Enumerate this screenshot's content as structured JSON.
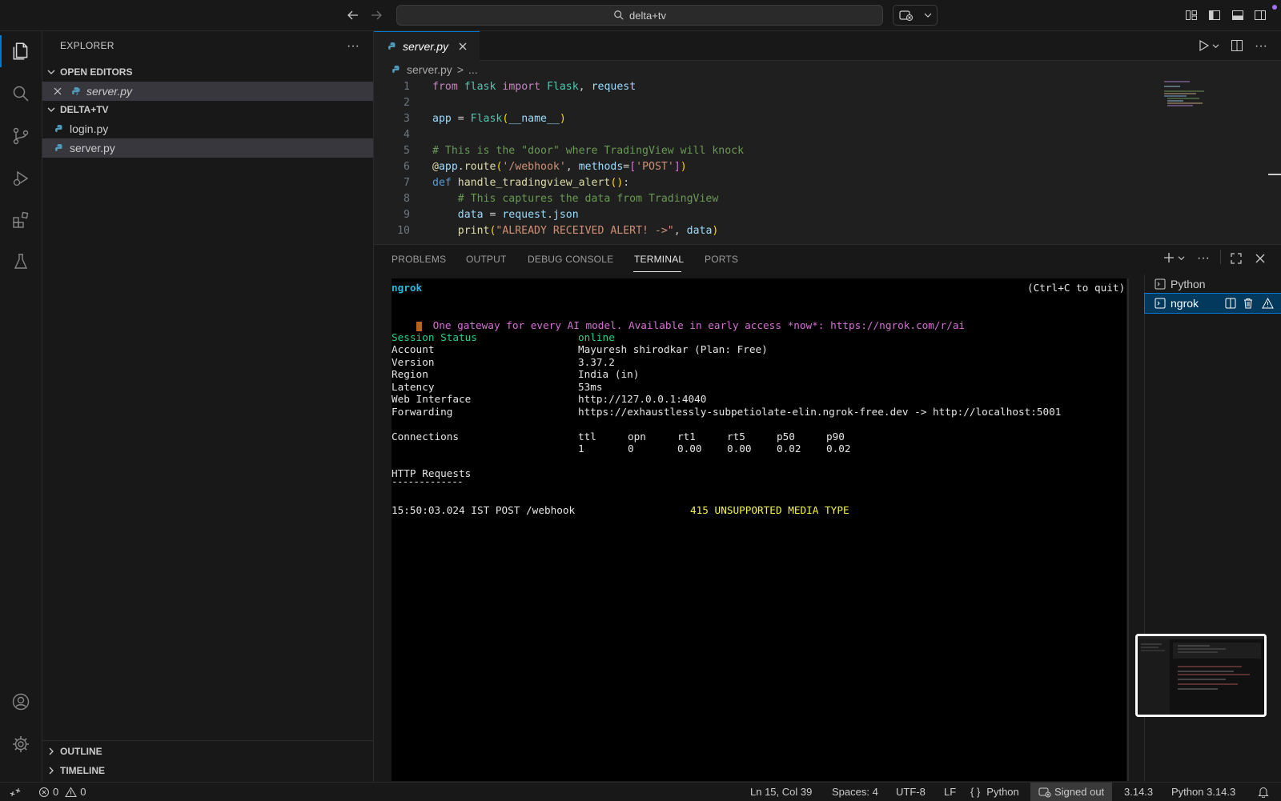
{
  "titlebar": {
    "search_text": "delta+tv"
  },
  "sidebar": {
    "title": "EXPLORER",
    "more": "···",
    "open_editors_label": "OPEN EDITORS",
    "open_editors": [
      {
        "label": "server.py"
      }
    ],
    "folder_label": "DELTA+TV",
    "files": [
      {
        "label": "login.py"
      },
      {
        "label": "server.py"
      }
    ],
    "outline_label": "OUTLINE",
    "timeline_label": "TIMELINE"
  },
  "editor": {
    "active_tab": "server.py",
    "breadcrumb": {
      "file": "server.py",
      "separator": ">",
      "rest": "..."
    },
    "line_numbers": [
      "1",
      "2",
      "3",
      "4",
      "5",
      "6",
      "7",
      "8",
      "9",
      "10"
    ],
    "lines": [
      "from flask import Flask, request",
      "",
      "app = Flask(__name__)",
      "",
      "# This is the \"door\" where TradingView will knock",
      "@app.route('/webhook', methods=['POST'])",
      "def handle_tradingview_alert():",
      "    # This captures the data from TradingView",
      "    data = request.json",
      "    print(\"ALREADY RECEIVED ALERT! ->\", data)"
    ]
  },
  "panel": {
    "tabs": [
      {
        "label": "PROBLEMS"
      },
      {
        "label": "OUTPUT"
      },
      {
        "label": "DEBUG CONSOLE"
      },
      {
        "label": "TERMINAL"
      },
      {
        "label": "PORTS"
      }
    ],
    "active_tab": "TERMINAL",
    "terminals": [
      {
        "label": "Python"
      },
      {
        "label": "ngrok"
      }
    ]
  },
  "terminal": {
    "app_name": "ngrok",
    "quit_hint": "(Ctrl+C to quit)",
    "announcement": "One gateway for every AI model. Available in early access *now*: https://ngrok.com/r/ai",
    "session_status_label": "Session Status",
    "session_status_value": "online",
    "rows": [
      {
        "label": "Account",
        "value": "Mayuresh shirodkar (Plan: Free)"
      },
      {
        "label": "Version",
        "value": "3.37.2"
      },
      {
        "label": "Region",
        "value": "India (in)"
      },
      {
        "label": "Latency",
        "value": "53ms"
      },
      {
        "label": "Web Interface",
        "value": "http://127.0.0.1:4040"
      },
      {
        "label": "Forwarding",
        "value": "https://exhaustlessly-subpetiolate-elin.ngrok-free.dev -> http://localhost:5001"
      }
    ],
    "connections_label": "Connections",
    "connections_headers": [
      "ttl",
      "opn",
      "rt1",
      "rt5",
      "p50",
      "p90"
    ],
    "connections_values": [
      "1",
      "0",
      "0.00",
      "0.00",
      "0.02",
      "0.02"
    ],
    "http_requests_label": "HTTP Requests",
    "http_requests_rule": "-------------",
    "request": {
      "entry": "15:50:03.024 IST POST /webhook",
      "status": "415 UNSUPPORTED MEDIA TYPE"
    }
  },
  "statusbar": {
    "errors": "0",
    "warnings": "0",
    "position": "Ln 15, Col 39",
    "spaces": "Spaces: 4",
    "encoding": "UTF-8",
    "eol": "LF",
    "language_brace": "{ }",
    "language": "Python",
    "account": "Signed out",
    "python_version_short": "3.14.3",
    "interpreter": "Python 3.14.3"
  },
  "colors": {
    "accent": "#0078d4",
    "editor_bg": "#1f1f1f",
    "chrome_bg": "#181818",
    "terminal_bg": "#000000",
    "status_online": "#23d18b",
    "status_error": "#f5f543"
  }
}
